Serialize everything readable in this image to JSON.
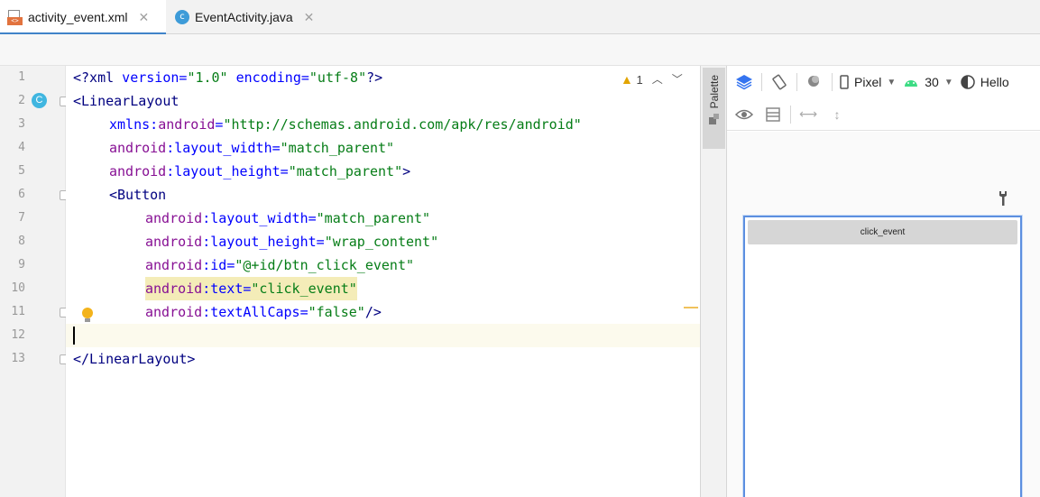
{
  "tabs": [
    {
      "label": "activity_event.xml",
      "icon": "xml-file-icon",
      "active": true
    },
    {
      "label": "EventActivity.java",
      "icon": "java-class-icon",
      "active": false
    }
  ],
  "editor": {
    "warning_count": "1",
    "lines": [
      {
        "no": "1"
      },
      {
        "no": "2"
      },
      {
        "no": "3"
      },
      {
        "no": "4"
      },
      {
        "no": "5"
      },
      {
        "no": "6"
      },
      {
        "no": "7"
      },
      {
        "no": "8"
      },
      {
        "no": "9"
      },
      {
        "no": "10"
      },
      {
        "no": "11"
      },
      {
        "no": "12"
      },
      {
        "no": "13"
      }
    ],
    "code": {
      "l1_pi_open": "<?xml",
      "l1_v_attr": " version=",
      "l1_v_val": "\"1.0\"",
      "l1_e_attr": " encoding=",
      "l1_e_val": "\"utf-8\"",
      "l1_pi_close": "?>",
      "l2_tag": "<LinearLayout",
      "l3_ns": "xmlns:",
      "l3_attr": "android",
      "l3_eq": "=",
      "l3_val": "\"http://schemas.android.com/apk/res/android\"",
      "l4_ns": "android",
      "l4_attr": ":layout_width",
      "l4_eq": "=",
      "l4_val": "\"match_parent\"",
      "l5_ns": "android",
      "l5_attr": ":layout_height",
      "l5_eq": "=",
      "l5_val": "\"match_parent\"",
      "l5_end": ">",
      "l6_tag": "<Button",
      "l7_ns": "android",
      "l7_attr": ":layout_width",
      "l7_eq": "=",
      "l7_val": "\"match_parent\"",
      "l8_ns": "android",
      "l8_attr": ":layout_height",
      "l8_eq": "=",
      "l8_val": "\"wrap_content\"",
      "l9_ns": "android",
      "l9_attr": ":id",
      "l9_eq": "=",
      "l9_val": "\"@+id/btn_click_event\"",
      "l10_ns": "android",
      "l10_attr": ":text",
      "l10_eq": "=",
      "l10_val": "\"click_event\"",
      "l11_ns": "android",
      "l11_attr": ":textAllCaps",
      "l11_eq": "=",
      "l11_val": "\"false\"",
      "l11_end": "/>",
      "l13_tag": "</LinearLayout>"
    },
    "gutter_class_badge": "C"
  },
  "palette": {
    "label": "Palette"
  },
  "design_toolbar": {
    "device": "Pixel",
    "api_level": "30",
    "theme": "Hello"
  },
  "preview": {
    "button_text": "click_event"
  },
  "colors": {
    "tab_accent": "#4083c9",
    "selection_border": "#5c8fe0",
    "xml_tag": "#000080",
    "xml_namespace": "#871094",
    "xml_string": "#067d17"
  }
}
